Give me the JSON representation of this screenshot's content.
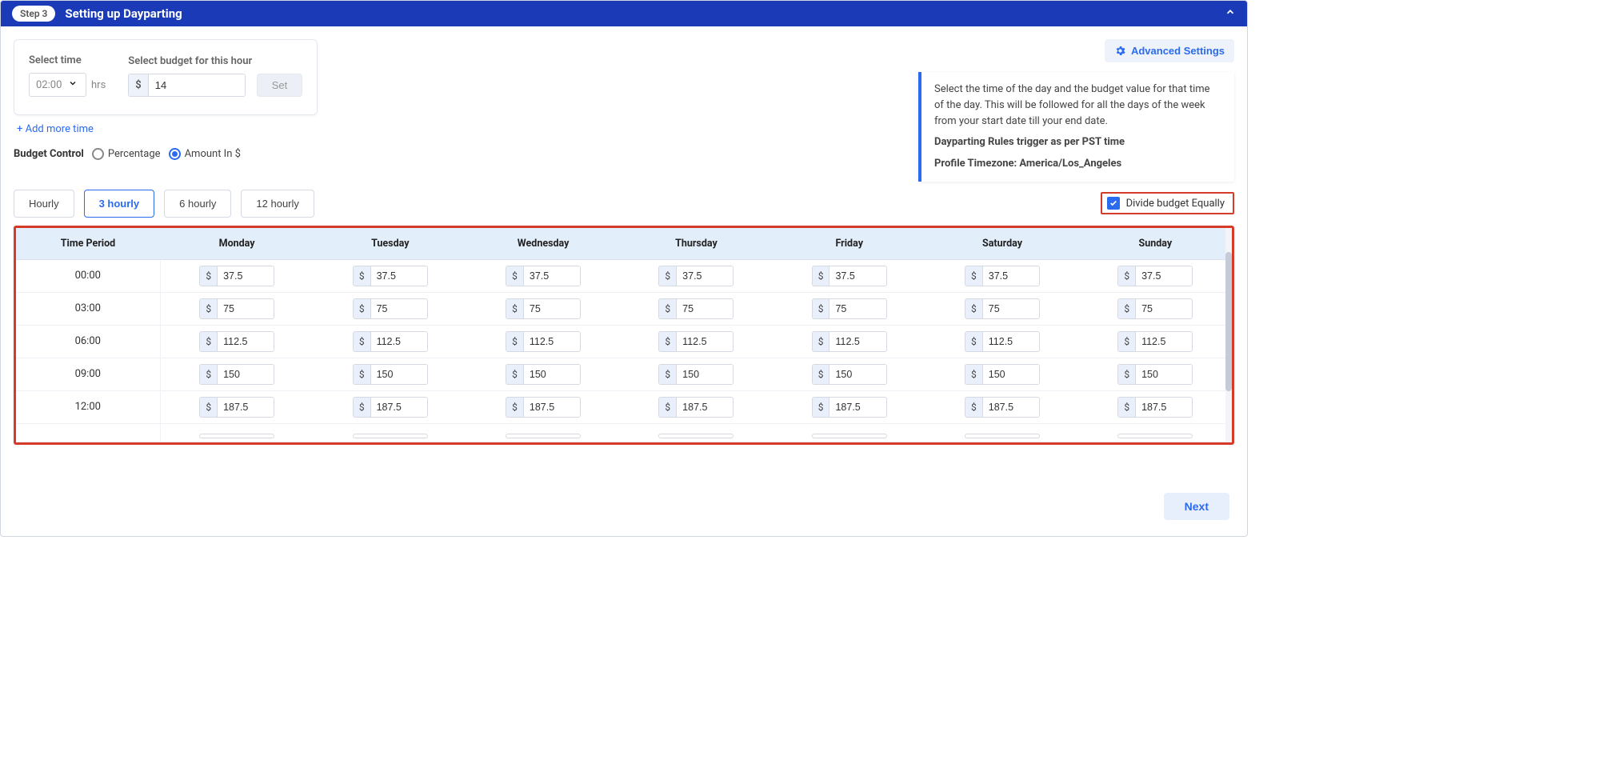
{
  "header": {
    "step_badge": "Step 3",
    "title": "Setting up Dayparting"
  },
  "advanced_settings_label": "Advanced Settings",
  "time_section": {
    "select_time_label": "Select time",
    "time_value": "02:00",
    "hrs_label": "hrs",
    "select_budget_label": "Select budget for this hour",
    "currency": "$",
    "budget_value": "14",
    "set_label": "Set",
    "add_more_label": "+ Add more time"
  },
  "info_box": {
    "line1": "Select the time of the day and the budget value for that time of the day. This will be followed for all the days of the week from your start date till your end date.",
    "line2": "Dayparting Rules trigger as per PST time",
    "line3": "Profile Timezone: America/Los_Angeles"
  },
  "budget_control": {
    "label": "Budget Control",
    "percentage_label": "Percentage",
    "amount_label": "Amount In $"
  },
  "hour_tabs": [
    "Hourly",
    "3 hourly",
    "6 hourly",
    "12 hourly"
  ],
  "hour_tab_selected": 1,
  "divide_label": "Divide budget Equally",
  "table": {
    "head": [
      "Time Period",
      "Monday",
      "Tuesday",
      "Wednesday",
      "Thursday",
      "Friday",
      "Saturday",
      "Sunday"
    ],
    "rows": [
      {
        "time": "00:00",
        "vals": [
          "37.5",
          "37.5",
          "37.5",
          "37.5",
          "37.5",
          "37.5",
          "37.5"
        ]
      },
      {
        "time": "03:00",
        "vals": [
          "75",
          "75",
          "75",
          "75",
          "75",
          "75",
          "75"
        ]
      },
      {
        "time": "06:00",
        "vals": [
          "112.5",
          "112.5",
          "112.5",
          "112.5",
          "112.5",
          "112.5",
          "112.5"
        ]
      },
      {
        "time": "09:00",
        "vals": [
          "150",
          "150",
          "150",
          "150",
          "150",
          "150",
          "150"
        ]
      },
      {
        "time": "12:00",
        "vals": [
          "187.5",
          "187.5",
          "187.5",
          "187.5",
          "187.5",
          "187.5",
          "187.5"
        ]
      }
    ]
  },
  "next_label": "Next"
}
